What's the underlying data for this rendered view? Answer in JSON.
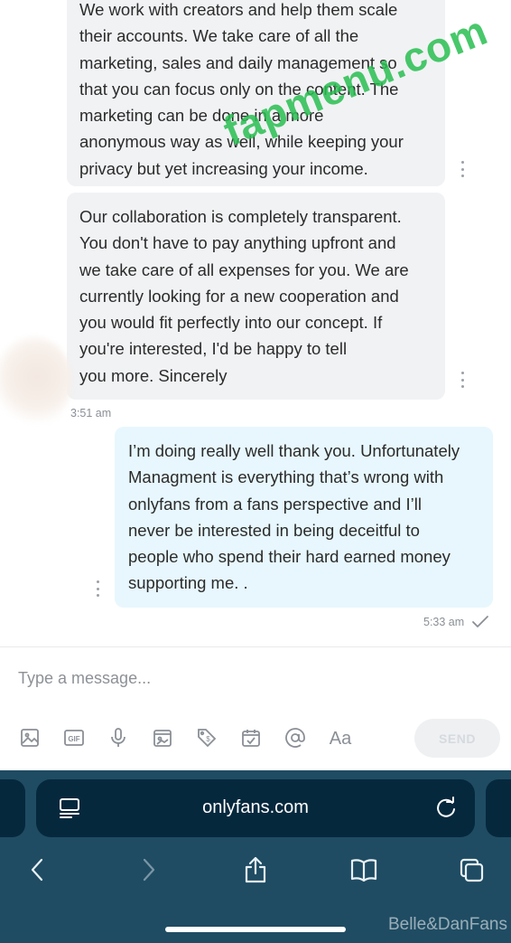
{
  "messages": [
    {
      "direction": "incoming",
      "lines": [
        "We work with creators and help them scale",
        "their accounts. We take care of all the",
        "marketing, sales and daily management so",
        "that you can focus only on the content. The",
        "marketing can be done in a more",
        "anonymous way as well, while keeping your",
        "privacy but yet increasing your income."
      ]
    },
    {
      "direction": "incoming",
      "lines": [
        "Our collaboration is completely transparent.",
        "You don't have to pay anything upfront and",
        "we take care of all expenses for you. We are",
        "currently looking for a new cooperation and",
        "you would fit perfectly into our concept. If",
        "you're interested, I'd be happy to tell",
        "you more. Sincerely"
      ],
      "time": "3:51 am"
    },
    {
      "direction": "outgoing",
      "lines": [
        "I’m doing really well thank you. Unfortunately",
        "Managment is everything that’s wrong with",
        "onlyfans from a fans perspective and I’ll",
        "never be interested in being deceitful to",
        "people who spend their hard earned money",
        "supporting me. ."
      ],
      "time": "5:33 am"
    }
  ],
  "watermark": "fapmenu.com",
  "composer": {
    "placeholder": "Type a message...",
    "send_label": "SEND",
    "tools": [
      "image-icon",
      "gif-icon",
      "microphone-icon",
      "vault-icon",
      "price-tag-icon",
      "schedule-icon",
      "mention-icon",
      "text-format-icon"
    ]
  },
  "browser": {
    "url": "onlyfans.com",
    "credit": "Belle&DanFans",
    "bg_color": "#1f4c63",
    "urlbar_color": "#06283d"
  },
  "colors": {
    "incoming_bubble": "#f1f2f4",
    "outgoing_bubble": "#e7f7fd",
    "watermark": "#28be50"
  }
}
